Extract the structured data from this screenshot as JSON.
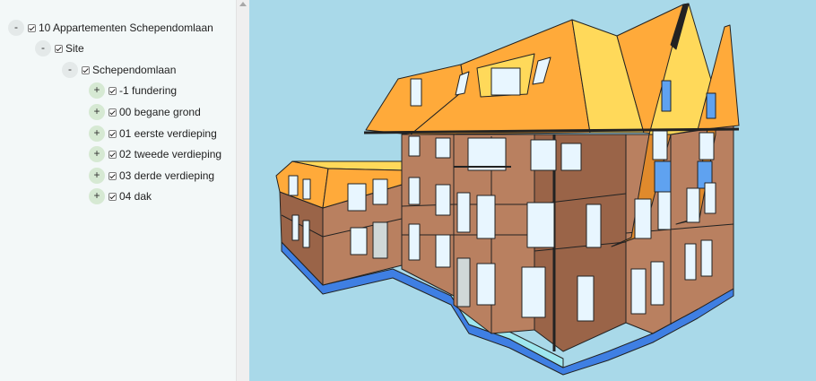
{
  "tree": {
    "nodes": [
      {
        "label": "10 Appartementen Schependomlaan",
        "toggle": "-",
        "checked": true
      },
      {
        "label": "Site",
        "toggle": "-",
        "checked": true
      },
      {
        "label": "Schependomlaan",
        "toggle": "-",
        "checked": true
      },
      {
        "label": "-1 fundering",
        "toggle": "+",
        "checked": true
      },
      {
        "label": "00 begane grond",
        "toggle": "+",
        "checked": true
      },
      {
        "label": "01 eerste verdieping",
        "toggle": "+",
        "checked": true
      },
      {
        "label": "02 tweede verdieping",
        "toggle": "+",
        "checked": true
      },
      {
        "label": "03 derde verdieping",
        "toggle": "+",
        "checked": true
      },
      {
        "label": "04 dak",
        "toggle": "+",
        "checked": true
      }
    ]
  },
  "viewport": {
    "background": "#a9d9e9",
    "colors": {
      "brick": "#b98060",
      "brick_dark": "#9a6448",
      "roof": "#ffaa3a",
      "roof_light": "#ffd95a",
      "glass": "#e8f6ff",
      "glass_blue": "#5fa2f0",
      "foundation": "#3f7fe3",
      "wood": "#e08a2c"
    }
  }
}
